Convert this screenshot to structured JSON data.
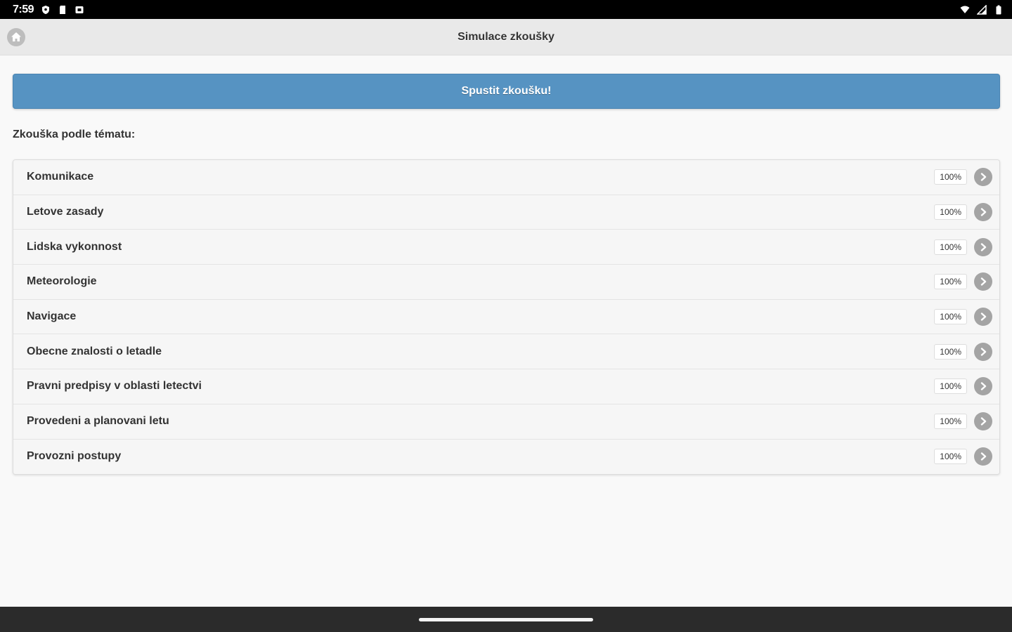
{
  "status_bar": {
    "time": "7:59",
    "left_icons": [
      "shield-icon",
      "sd-card-icon",
      "screenshot-icon"
    ],
    "right_icons": [
      "wifi-icon",
      "signal-icon",
      "battery-icon"
    ]
  },
  "header": {
    "title": "Simulace zkoušky",
    "home_icon": "home-icon"
  },
  "main": {
    "start_button_label": "Spustit zkoušku!",
    "section_label": "Zkouška podle tématu:",
    "topics": [
      {
        "label": "Komunikace",
        "count": "100%"
      },
      {
        "label": "Letove zasady",
        "count": "100%"
      },
      {
        "label": "Lidska vykonnost",
        "count": "100%"
      },
      {
        "label": "Meteorologie",
        "count": "100%"
      },
      {
        "label": "Navigace",
        "count": "100%"
      },
      {
        "label": "Obecne znalosti o letadle",
        "count": "100%"
      },
      {
        "label": "Pravni predpisy v oblasti letectvi",
        "count": "100%"
      },
      {
        "label": "Provedeni a planovani letu",
        "count": "100%"
      },
      {
        "label": "Provozni postupy",
        "count": "100%"
      }
    ]
  },
  "colors": {
    "accent": "#5693c2",
    "header_bg": "#e9e9e9",
    "page_bg": "#f9f9f9"
  }
}
